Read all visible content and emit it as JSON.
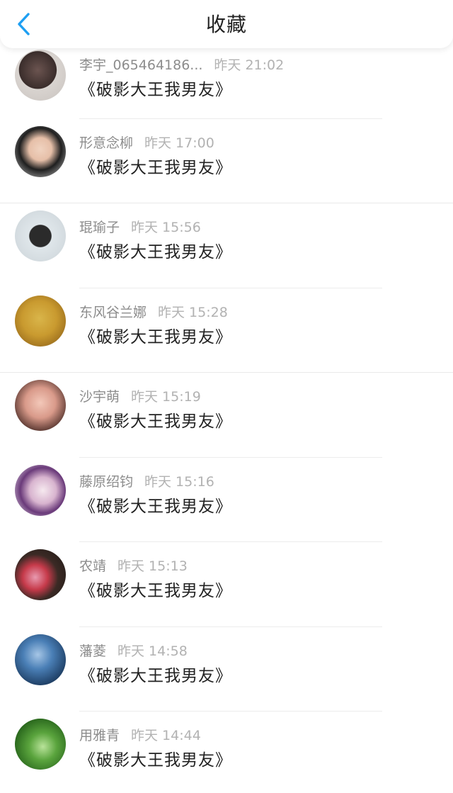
{
  "header": {
    "title": "收藏",
    "back_icon": "chevron-left-icon",
    "accent": "#1e9ff2"
  },
  "items": [
    {
      "name": "李宇_065464186...",
      "time": "昨天 21:02",
      "message": "《破影大王我男友》"
    },
    {
      "name": "形意念柳",
      "time": "昨天 17:00",
      "message": "《破影大王我男友》"
    },
    {
      "name": "琨瑜子",
      "time": "昨天 15:56",
      "message": "《破影大王我男友》"
    },
    {
      "name": "东风谷兰娜",
      "time": "昨天 15:28",
      "message": "《破影大王我男友》"
    },
    {
      "name": "沙宇萌",
      "time": "昨天 15:19",
      "message": "《破影大王我男友》"
    },
    {
      "name": "藤原绍钧",
      "time": "昨天 15:16",
      "message": "《破影大王我男友》"
    },
    {
      "name": "农靖",
      "time": "昨天 15:13",
      "message": "《破影大王我男友》"
    },
    {
      "name": "藩菱",
      "time": "昨天 14:58",
      "message": "《破影大王我男友》"
    },
    {
      "name": "用雅青",
      "time": "昨天 14:44",
      "message": "《破影大王我男友》"
    }
  ]
}
